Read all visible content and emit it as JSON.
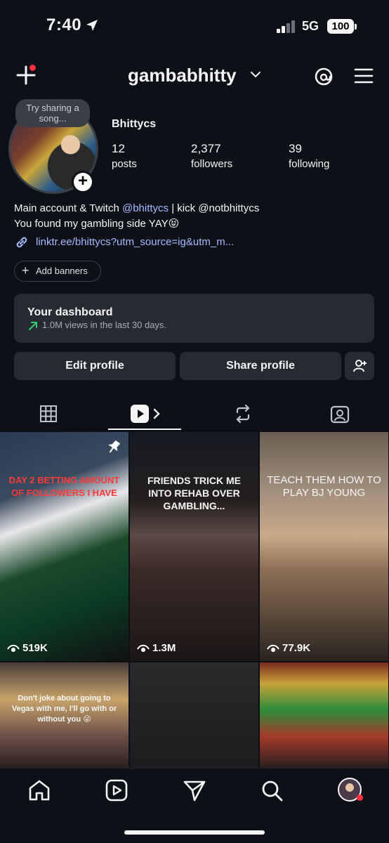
{
  "status_bar": {
    "time": "7:40",
    "network": "5G",
    "battery": "100"
  },
  "header": {
    "username": "gambabhitty"
  },
  "profile": {
    "note": "Try sharing a song...",
    "display_name": "Bhittycs",
    "stats": [
      {
        "value": "12",
        "label": "posts"
      },
      {
        "value": "2,377",
        "label": "followers"
      },
      {
        "value": "39",
        "label": "following"
      }
    ],
    "bio_line1_prefix": "Main account & Twitch ",
    "bio_mention1": "@bhittycs",
    "bio_line1_middle": " | kick ",
    "bio_mention2": "@notbhittycs",
    "bio_line2": "You found my gambling side YAY😝",
    "link": "linktr.ee/bhittycs?utm_source=ig&utm_m..."
  },
  "add_banners": "Add banners",
  "dashboard": {
    "title": "Your dashboard",
    "subtitle": "1.0M views in the last 30 days."
  },
  "actions": {
    "edit": "Edit profile",
    "share": "Share profile"
  },
  "posts": [
    {
      "caption": "DAY 2 BETTING AMOUNT OF FOLLOWERS I HAVE",
      "views": "519K",
      "pinned": true
    },
    {
      "caption": "FRIENDS TRICK ME INTO REHAB OVER GAMBLING...",
      "views": "1.3M"
    },
    {
      "caption": "TEACH THEM HOW TO PLAY BJ YOUNG",
      "views": "77.9K"
    },
    {
      "caption": "Don't joke about going to Vegas with me, I'll go with or without you 😜",
      "views": ""
    },
    {
      "caption": "",
      "views": ""
    },
    {
      "caption": "",
      "views": ""
    }
  ],
  "colors": {
    "background": "#0d1117",
    "link": "#a8b8ff",
    "notification": "#ff3040"
  }
}
